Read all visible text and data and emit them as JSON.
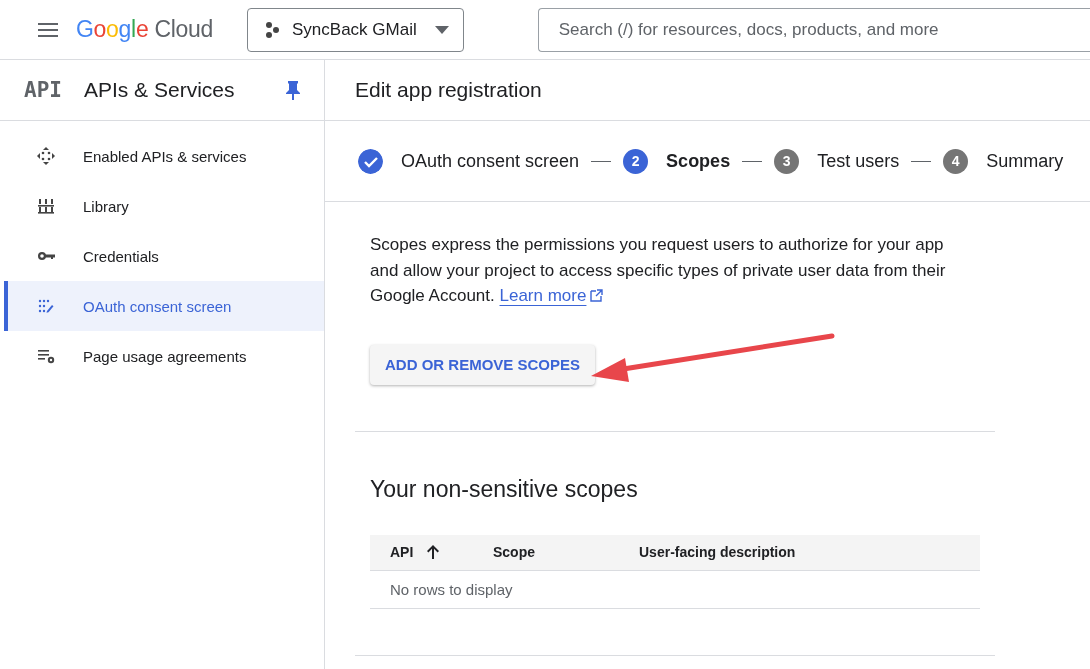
{
  "topbar": {
    "logo": {
      "google": "Google",
      "product": "Cloud"
    },
    "project": "SyncBack GMail",
    "search": {
      "placeholder": "Search (/) for resources, docs, products, and more"
    }
  },
  "sidebar": {
    "badge": "API",
    "title": "APIs & Services",
    "pinned": true,
    "items": [
      {
        "label": "Enabled APIs & services",
        "kind": "hub",
        "selected": false
      },
      {
        "label": "Library",
        "kind": "library",
        "selected": false
      },
      {
        "label": "Credentials",
        "kind": "key",
        "selected": false
      },
      {
        "label": "OAuth consent screen",
        "kind": "consent",
        "selected": true
      },
      {
        "label": "Page usage agreements",
        "kind": "settings",
        "selected": false
      }
    ]
  },
  "page": {
    "title": "Edit app registration",
    "steps": [
      {
        "label": "OAuth consent screen",
        "completed": true,
        "selected": false
      },
      {
        "number": "2",
        "label": "Scopes",
        "completed": false,
        "selected": true
      },
      {
        "number": "3",
        "label": "Test users",
        "completed": false,
        "selected": false
      },
      {
        "number": "4",
        "label": "Summary",
        "completed": false,
        "selected": false
      }
    ],
    "intro": "Scopes express the permissions you request users to authorize for your app and allow your project to access specific types of private user data from their Google Account.",
    "learn_more": "Learn more",
    "add_button": "ADD OR REMOVE SCOPES",
    "section_title": "Your non-sensitive scopes",
    "table": {
      "columns": [
        {
          "label": "API",
          "sorted": true
        },
        {
          "label": "Scope",
          "sorted": false
        },
        {
          "label": "User-facing description",
          "sorted": false
        }
      ],
      "empty": "No rows to display"
    }
  }
}
